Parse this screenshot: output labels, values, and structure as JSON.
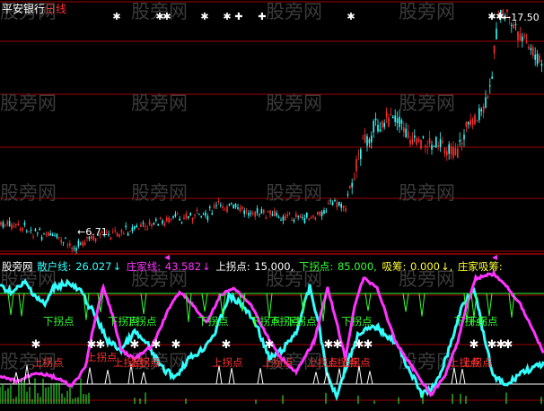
{
  "header": {
    "stock_name": "平安银行",
    "period": "日线",
    "high_label": "17.50",
    "low_label": "6.71",
    "colors": {
      "stock_name": "#ffffff",
      "period": "#ff3030",
      "price_label": "#ffffff"
    }
  },
  "indicator": {
    "name": "股旁网",
    "items": [
      {
        "label": "散户线:",
        "value": "26.027",
        "arrow": "↓",
        "color": "#33ffff"
      },
      {
        "label": "庄家线:",
        "value": "43.582",
        "arrow": "↓",
        "color": "#ff33ff"
      },
      {
        "label": "上拐点:",
        "value": "15.000,",
        "arrow": "",
        "color": "#ffffff"
      },
      {
        "label": "下拐点:",
        "value": "85.000,",
        "arrow": "",
        "color": "#33ff33"
      },
      {
        "label": "吸筹:",
        "value": "0.000",
        "arrow": "↓,",
        "color": "#ffff33"
      },
      {
        "label": "庄家吸筹:",
        "value": "",
        "arrow": "",
        "color": "#ffff33"
      }
    ]
  },
  "signals": {
    "down_turn_label": "下拐点",
    "up_turn_label": "上拐点",
    "down_color": "#33ff33",
    "up_color": "#ff3030"
  },
  "watermark": {
    "text": "股旁网",
    "color": "#3a3a3a"
  },
  "colors": {
    "background": "#000000",
    "grid": "#a00000",
    "candle_up": "#ff3030",
    "candle_down": "#33ffff",
    "retail_line": "#33ffff",
    "banker_line": "#ff33ff",
    "threshold_line": "#33ff33",
    "marker": "#ffffff"
  }
}
